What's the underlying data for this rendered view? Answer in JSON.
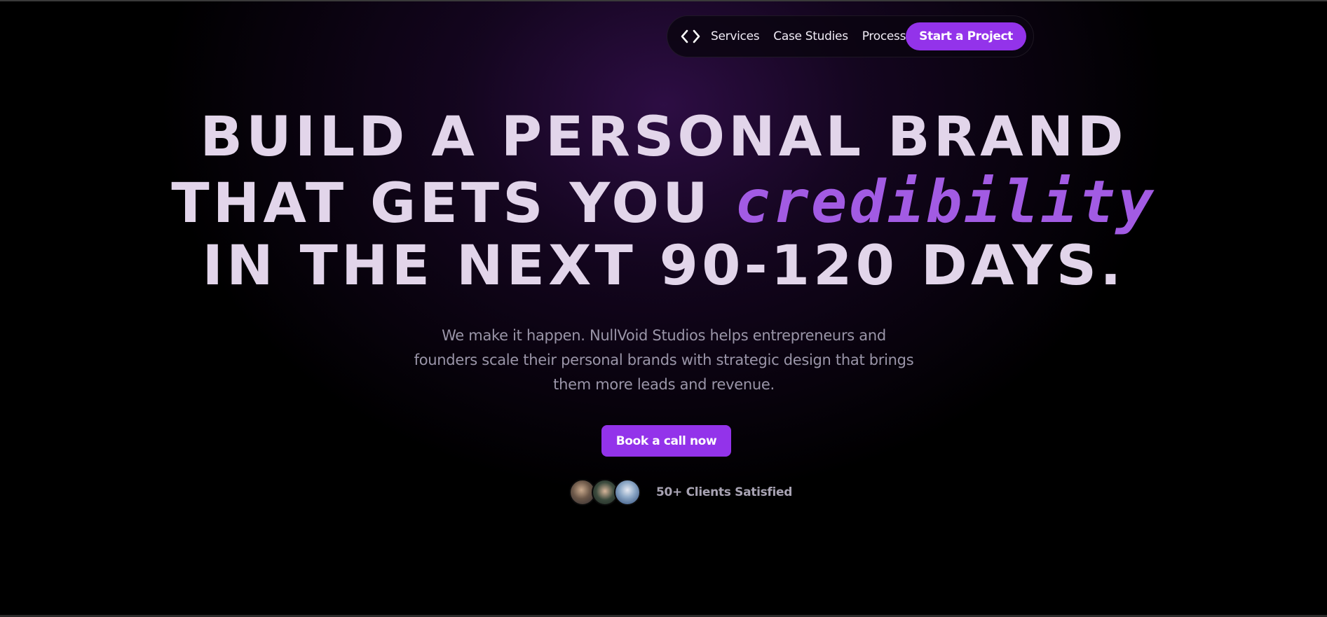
{
  "nav": {
    "logo_icon": "code-brackets-icon",
    "links": [
      "Services",
      "Case Studies",
      "Process"
    ],
    "cta_label": "Start a Project"
  },
  "hero": {
    "headline_line1": "BUILD A PERSONAL BRAND",
    "headline_line2_prefix": "THAT GETS YOU ",
    "headline_line2_accent": "credibility",
    "headline_line3": "IN THE NEXT 90-120 DAYS.",
    "subtext": "We make it happen. NullVoid Studios helps entrepreneurs and founders scale their personal brands with strategic design that brings them more leads and revenue.",
    "button_label": "Book a call now",
    "clients_label": "50+ Clients Satisfied"
  },
  "colors": {
    "accent": "#9333ea",
    "headline": "#e2d5ea",
    "accent_text": "#a25be3",
    "background": "#000000"
  }
}
